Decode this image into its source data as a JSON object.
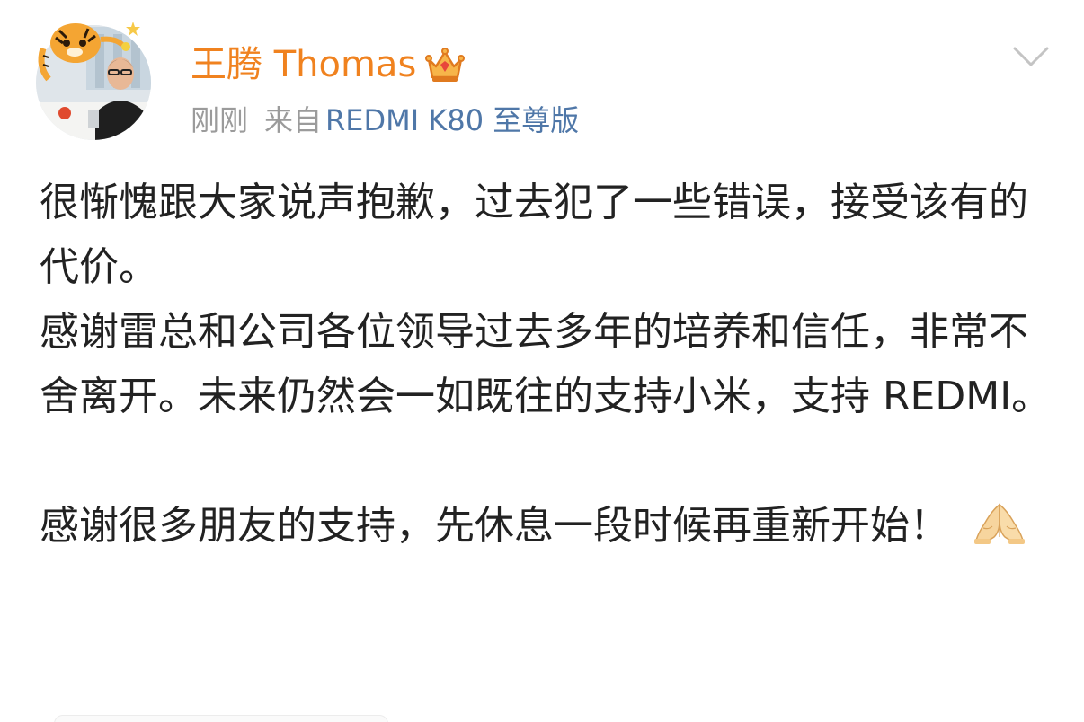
{
  "post": {
    "author": {
      "name": "王腾 Thomas",
      "badge_icon": "crown-icon"
    },
    "meta": {
      "time": "刚刚",
      "from_label": "来自",
      "device": "REDMI K80 至尊版"
    },
    "content": {
      "paragraph_1": "很惭愧跟大家说声抱歉，过去犯了一些错误，接受该有的代价。",
      "paragraph_2": "感谢雷总和公司各位领导过去多年的培养和信任，非常不舍离开。未来仍然会一如既往的支持小米，支持 REDMI。",
      "paragraph_3": "感谢很多朋友的支持，先休息一段时候再重新开始！",
      "emoji": "pray-hands-icon"
    }
  },
  "colors": {
    "author_name": "#f0821f",
    "meta_text": "#9b9b9b",
    "device_link": "#4f77a8",
    "body_text": "#222222"
  }
}
